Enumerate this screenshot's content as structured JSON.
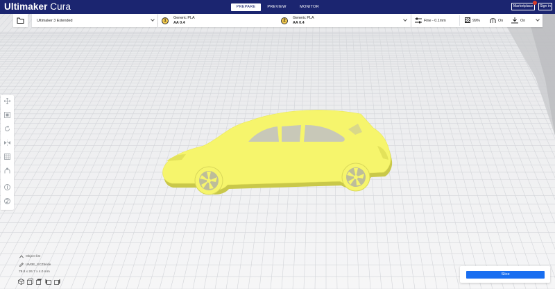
{
  "header": {
    "brand_bold": "Ultimaker",
    "brand_light": " Cura",
    "tabs": [
      "PREPARE",
      "PREVIEW",
      "MONITOR"
    ],
    "marketplace": "Marketplace",
    "sign_in": "Sign in"
  },
  "printer": {
    "name": "Ultimaker 3 Extended"
  },
  "extruders": [
    {
      "number": "1",
      "material": "Generic PLA",
      "core": "AA 0.4"
    },
    {
      "number": "2",
      "material": "Generic PLA",
      "core": "AA 0.4"
    }
  ],
  "settings": {
    "profile": "Fine - 0.1mm",
    "infill": "99%",
    "support": "On",
    "adhesion": "On"
  },
  "object_list": {
    "title": "Object list",
    "filename": "UM3E_SCZbride",
    "dimensions": "78.8 x 26.7 x 4.0 mm"
  },
  "slice": {
    "label": "Slice"
  },
  "colors": {
    "header": "#1b2570",
    "accent": "#196ef0",
    "model": "#f6f56c",
    "extruder_badge": "#f2c94c"
  }
}
